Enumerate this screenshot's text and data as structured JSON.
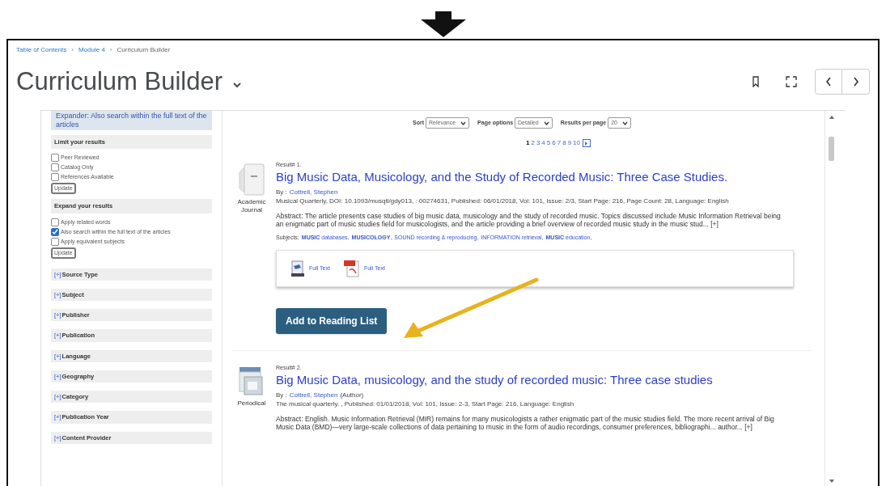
{
  "breadcrumb": [
    "Table of Contents",
    "Module 4",
    "Curriculum Builder"
  ],
  "breadcrumb_separator": "›",
  "title": "Curriculum Builder",
  "sidebar": {
    "expander_note": "Expander: Also search within the full text of the articles",
    "sections": [
      {
        "title": "Limit your results",
        "options": [
          {
            "label": "Peer Reviewed",
            "checked": false
          },
          {
            "label": "Catalog Only",
            "checked": false
          },
          {
            "label": "References Available",
            "checked": false
          }
        ],
        "button": "Update"
      },
      {
        "title": "Expand your results",
        "options": [
          {
            "label": "Apply related words",
            "checked": false
          },
          {
            "label": "Also search within the full text of the articles",
            "checked": true
          },
          {
            "label": "Apply equivalent subjects",
            "checked": false
          }
        ],
        "button": "Update"
      }
    ],
    "facets": [
      {
        "toggle": "[+]",
        "label": "Source Type"
      },
      {
        "toggle": "[+]",
        "label": "Subject"
      },
      {
        "toggle": "[+]",
        "label": "Publisher"
      },
      {
        "toggle": "[+]",
        "label": "Publication"
      },
      {
        "toggle": "[+]",
        "label": "Language"
      },
      {
        "toggle": "[+]",
        "label": "Geography"
      },
      {
        "toggle": "[+]",
        "label": "Category"
      },
      {
        "toggle": "[+]",
        "label": "Publication Year"
      },
      {
        "toggle": "[+]",
        "label": "Content Provider"
      }
    ]
  },
  "toolbar": [
    {
      "label": "Sort",
      "value": "Relevance"
    },
    {
      "label": "Page options",
      "value": "Detailed"
    },
    {
      "label": "Results per page",
      "value": "20"
    }
  ],
  "pagination": [
    {
      "label": "1",
      "selected": true
    },
    {
      "label": "2",
      "selected": false
    },
    {
      "label": "3",
      "selected": false
    },
    {
      "label": "4",
      "selected": false
    },
    {
      "label": "5",
      "selected": false
    },
    {
      "label": "6",
      "selected": false
    },
    {
      "label": "7",
      "selected": false
    },
    {
      "label": "8",
      "selected": false
    },
    {
      "label": "9",
      "selected": false
    },
    {
      "label": "10",
      "selected": false
    }
  ],
  "results": [
    {
      "number": "Result# 1.",
      "kind": "journal",
      "type": "Academic Journal",
      "title": "Big Music Data, Musicology, and the Study of Recorded Music: Three Case Studies.",
      "by": "By :",
      "author": "Cottrell, Stephen",
      "source": "Musical Quarterly, DOI: 10.1093/musqtl/gdy013, : 00274631, Published: 06/01/2018, Vol: 101, Issue: 2/3, Start Page: 216, Page Count: 28, Language: English",
      "abstract": "Abstract: The article presents case studies of big music data, musicology and the study of recorded music. Topics discussed include Music Information Retrieval being an enigmatic part of music studies field for musicologists, and the article providing a brief overview of recorded music study in the music stud... [+]",
      "subjects_label": "Subjects:",
      "subjects": [
        "**MUSIC** databases,",
        "**MUSICOLOGY**,",
        "SOUND recording & reproducing,",
        "INFORMATION retrieval,",
        "**MUSIC** education,"
      ],
      "links": [
        {
          "kind": "html",
          "label": "Full Text"
        },
        {
          "kind": "pdf",
          "label": "Full Text"
        }
      ],
      "button": "Add to Reading List"
    },
    {
      "number": "Result# 2.",
      "kind": "periodical",
      "type": "Periodical",
      "title": "Big Music Data, musicology, and the study of recorded music: Three case studies",
      "by": "By :",
      "author": "Cottrell, Stephen",
      "author_role": "(Author)",
      "source": "The musical quarterly. , Published: 01/01/2018, Vol: 101, Issue: 2-3, Start Page: 216, Language: English",
      "abstract": "Abstract: English. Music Information Retrieval (MIR) remains for many musicologists a rather enigmatic part of the music studies field. The more recent arrival of Big Music Data (BMD)—very large-scale collections of data pertaining to music in the form of audio recordings, consumer preferences, bibliographi... author... [+]"
    }
  ]
}
